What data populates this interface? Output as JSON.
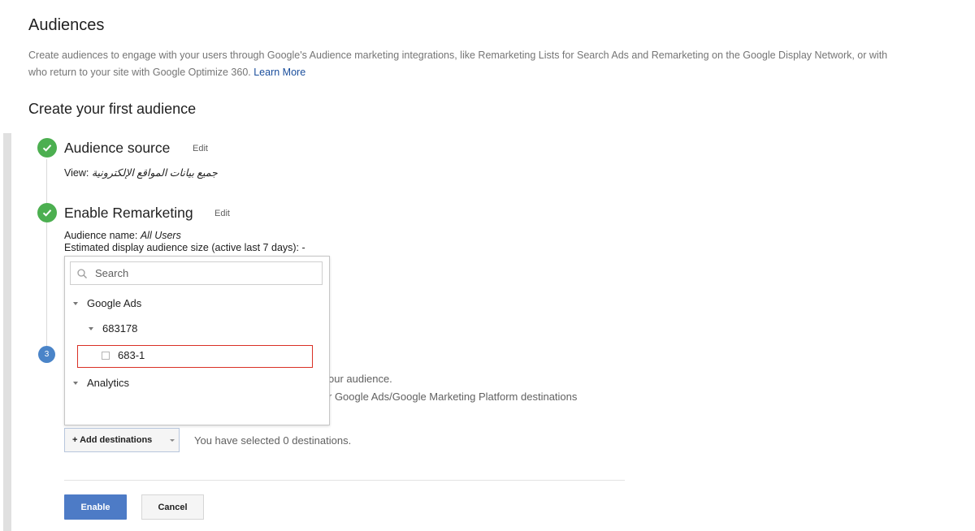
{
  "page": {
    "title": "Audiences",
    "intro_text": "Create audiences to engage with your users through Google's Audience marketing integrations, like Remarketing Lists for Search Ads and Remarketing on the Google Display Network, or with",
    "intro_text_line2": "who return to your site with Google Optimize 360.",
    "learn_more": "Learn More",
    "section_title": "Create your first audience"
  },
  "steps": {
    "step1": {
      "title": "Audience source",
      "edit": "Edit",
      "view_label": "View:",
      "view_value": "جميع بيانات المواقع الإلكترونية"
    },
    "step2": {
      "title": "Enable Remarketing",
      "edit": "Edit",
      "name_label": "Audience name:",
      "name_value": "All Users",
      "size_text": "Estimated display audience size (active last 7 days): -"
    },
    "step3": {
      "number": "3",
      "desc_line1": "our audience.",
      "desc_line2": "r Google Ads/Google Marketing Platform destinations"
    }
  },
  "dropdown": {
    "search_placeholder": "Search",
    "tree": {
      "group1": "Google Ads",
      "account": "683178",
      "item": "683-1",
      "group2": "Analytics"
    }
  },
  "destinations": {
    "add_button": "+ Add destinations",
    "status": "You have selected 0 destinations."
  },
  "actions": {
    "enable": "Enable",
    "cancel": "Cancel"
  },
  "colors": {
    "check_green": "#4caf50",
    "step_blue": "#4a84c8",
    "enable_blue": "#4d7bc6",
    "highlight_red": "#d93025",
    "link_blue": "#1a4e9c"
  },
  "icons": {
    "step_done": "check-circle-icon",
    "search": "search-icon",
    "expand": "caret-down-icon"
  }
}
